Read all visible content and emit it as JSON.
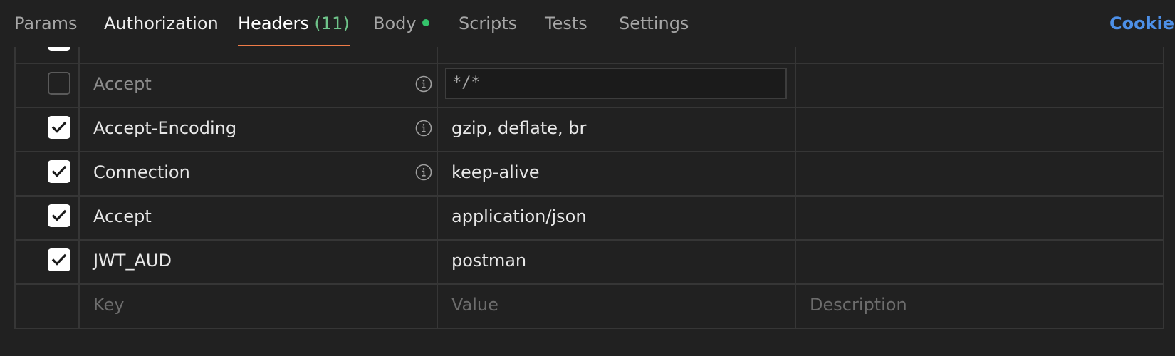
{
  "tabs": [
    {
      "label": "Params"
    },
    {
      "label": "Authorization"
    },
    {
      "label": "Headers",
      "count": "(11)"
    },
    {
      "label": "Body"
    },
    {
      "label": "Scripts"
    },
    {
      "label": "Tests"
    },
    {
      "label": "Settings"
    }
  ],
  "cookies_label": "Cookies",
  "headers": [
    {
      "key": "Accept",
      "value": "*/*",
      "checked": false
    },
    {
      "key": "Accept-Encoding",
      "value": "gzip, deflate, br",
      "checked": true
    },
    {
      "key": "Connection",
      "value": "keep-alive",
      "checked": true
    },
    {
      "key": "Accept",
      "value": "application/json",
      "checked": true
    },
    {
      "key": "JWT_AUD",
      "value": "postman",
      "checked": true
    }
  ],
  "new_row": {
    "key_placeholder": "Key",
    "value_placeholder": "Value",
    "description_placeholder": "Description"
  },
  "colors": {
    "active_tab_underline": "#ef7c48",
    "count": "#6fc38a",
    "body_dot": "#34c46b",
    "link": "#4d90e8"
  }
}
